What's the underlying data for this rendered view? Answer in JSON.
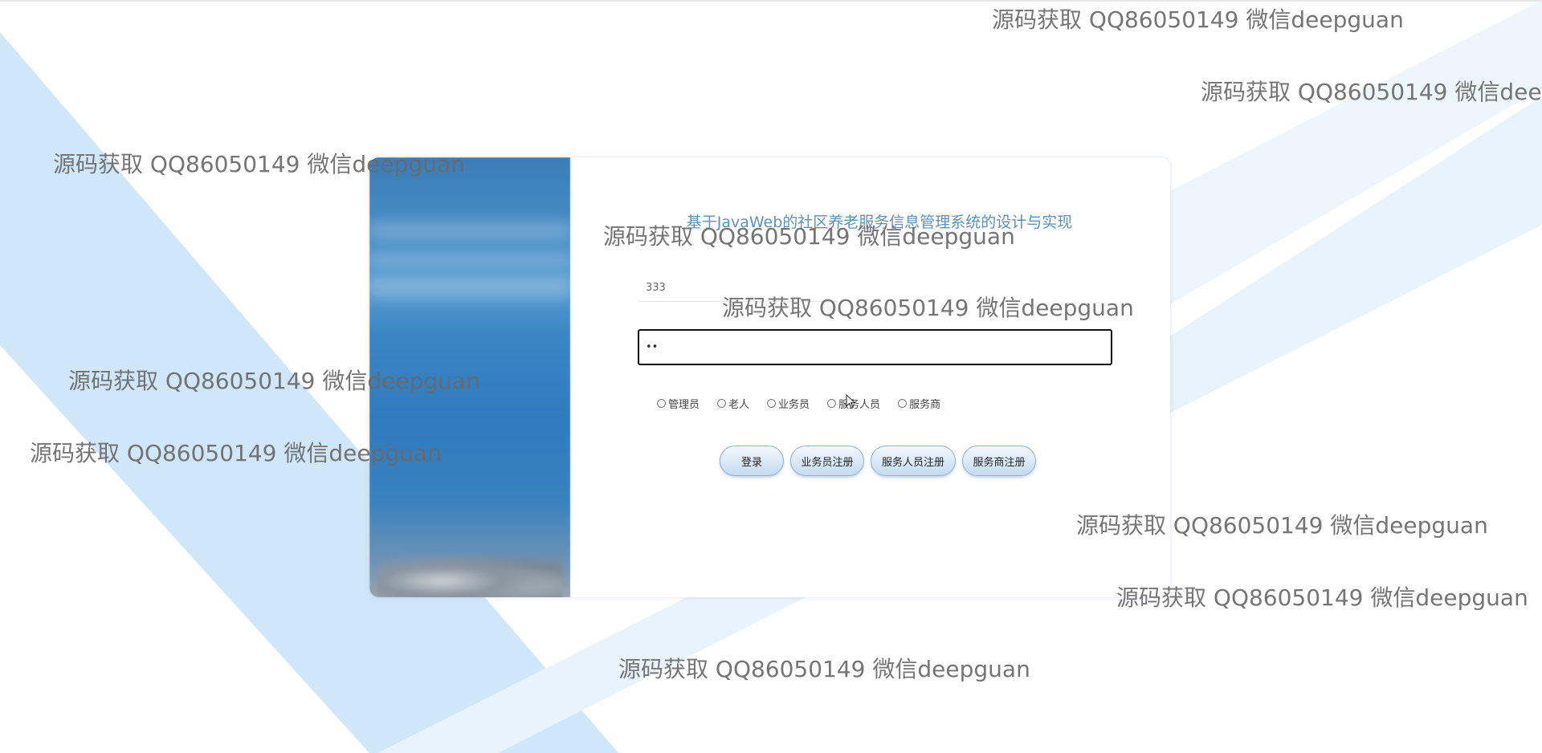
{
  "colors": {
    "background": "#ffffff",
    "stripe_light": "#dbeefb",
    "stripe_mid": "#cfe7f9",
    "title": "#5a93b8",
    "watermark": "#696969"
  },
  "login": {
    "title": "基于JavaWeb的社区养老服务信息管理系统的设计与实现",
    "username_value": "333",
    "password_value": "••",
    "roles": [
      {
        "label": "管理员",
        "selected": false
      },
      {
        "label": "老人",
        "selected": false
      },
      {
        "label": "业务员",
        "selected": false
      },
      {
        "label": "服务人员",
        "selected": false
      },
      {
        "label": "服务商",
        "selected": false
      }
    ],
    "buttons": {
      "login": "登录",
      "register_salesman": "业务员注册",
      "register_service_staff": "服务人员注册",
      "register_provider": "服务商注册"
    }
  },
  "watermark_text": "源码获取 QQ86050149 微信deepguan",
  "icons": {
    "cursor": "mouse-pointer-icon"
  }
}
